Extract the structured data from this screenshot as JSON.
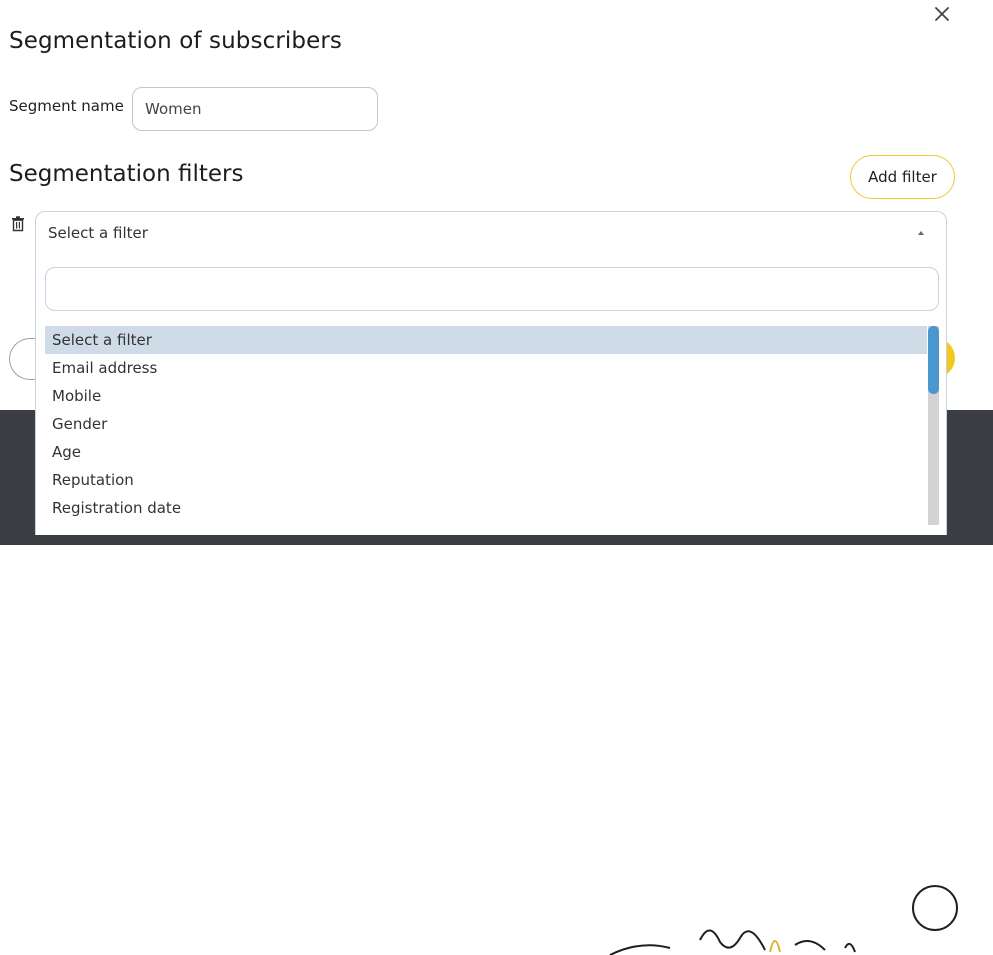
{
  "modal": {
    "title": "Segmentation of subscribers",
    "segment_name_label": "Segment name",
    "segment_name_value": "Women",
    "filters_title": "Segmentation filters",
    "add_filter_label": "Add filter"
  },
  "filter_select": {
    "selected_value": "Select a filter",
    "search_value": "",
    "options": [
      "Select a filter",
      "Email address",
      "Mobile",
      "Gender",
      "Age",
      "Reputation",
      "Registration date"
    ],
    "highlighted_option": "Select a filter"
  },
  "colors": {
    "accent_yellow": "#f2c81d",
    "highlight_blue": "#cfdce8",
    "scrollbar_thumb": "#4a97cf",
    "footer_dark": "#3b3e42"
  },
  "icons": [
    "close-icon",
    "trash-icon",
    "caret-up-icon"
  ]
}
